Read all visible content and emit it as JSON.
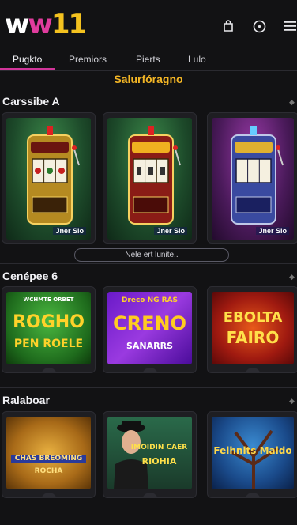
{
  "header": {
    "logo": {
      "part1": "w",
      "part2": "w",
      "part3": "11"
    },
    "icons": [
      "bag-icon",
      "circle-menu-icon",
      "hamburger-icon"
    ]
  },
  "tabs": [
    {
      "label": "Pugkto",
      "active": true
    },
    {
      "label": "Premiors",
      "active": false
    },
    {
      "label": "Pierts",
      "active": false
    },
    {
      "label": "Lulo",
      "active": false
    }
  ],
  "banner": "Salurfóragno",
  "sections": [
    {
      "title": "Carssibe A",
      "games": [
        {
          "tag": "Jner Slo",
          "theme": "green-slot"
        },
        {
          "tag": "Jner Slo",
          "theme": "red-slot"
        },
        {
          "tag": "Jner Slo",
          "theme": "purple-slot"
        }
      ],
      "more_label": "Nele ert lunite.."
    },
    {
      "title": "Cenépee 6",
      "games": [
        {
          "title_top": "WCHMTE ORBET",
          "title_main": "ROGHO",
          "title_sub": "PEN ROELE",
          "theme": "green"
        },
        {
          "title_top": "Dreco NG RAS",
          "title_main": "CRENO",
          "title_sub": "SANARRS",
          "theme": "purple"
        },
        {
          "title_top": "",
          "title_main": "EBOLTA",
          "title_sub": "FAIRO",
          "theme": "red"
        }
      ]
    },
    {
      "title": "Ralaboar",
      "games": [
        {
          "title_main": "CHAS BREOMING",
          "title_sub": "ROCHA",
          "theme": "gold"
        },
        {
          "title_main": "IMOIDIN CAER",
          "title_sub": "RIOHIA",
          "theme": "gangster"
        },
        {
          "title_main": "Felhnits Maldo",
          "title_sub": "",
          "theme": "blue-tree"
        }
      ]
    }
  ],
  "colors": {
    "accent": "#d2359a",
    "banner": "#f4b625",
    "background": "#121214"
  }
}
